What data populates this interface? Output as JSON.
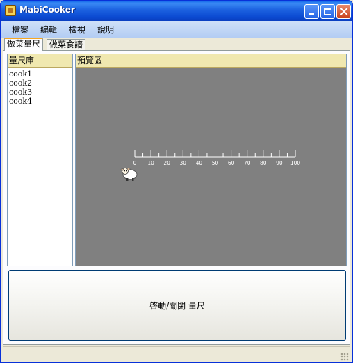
{
  "window": {
    "title": "MabiCooker"
  },
  "menu": {
    "items": [
      "檔案",
      "編輯",
      "檢視",
      "說明"
    ]
  },
  "tabs": [
    {
      "label": "做菜量尺",
      "active": true
    },
    {
      "label": "做菜食譜",
      "active": false
    }
  ],
  "library": {
    "header": "量尺庫",
    "items": [
      "cook1",
      "cook2",
      "cook3",
      "cook4"
    ]
  },
  "preview": {
    "header": "預覽區",
    "background_color": "#808080",
    "ruler": {
      "min": 0,
      "max": 100,
      "major_step": 10,
      "minor_step": 5,
      "tick_labels": [
        "0",
        "10",
        "20",
        "30",
        "40",
        "50",
        "60",
        "70",
        "80",
        "90",
        "100"
      ]
    },
    "sheep_icon": "sheep-icon"
  },
  "actions": {
    "toggle_label": "啓動/關閉 量尺"
  },
  "colors": {
    "titlebar": "#0a4ad2",
    "menubar": "#c0d6f5",
    "header_bg": "#f0e8b0",
    "active_tab_accent": "#f5a623"
  }
}
